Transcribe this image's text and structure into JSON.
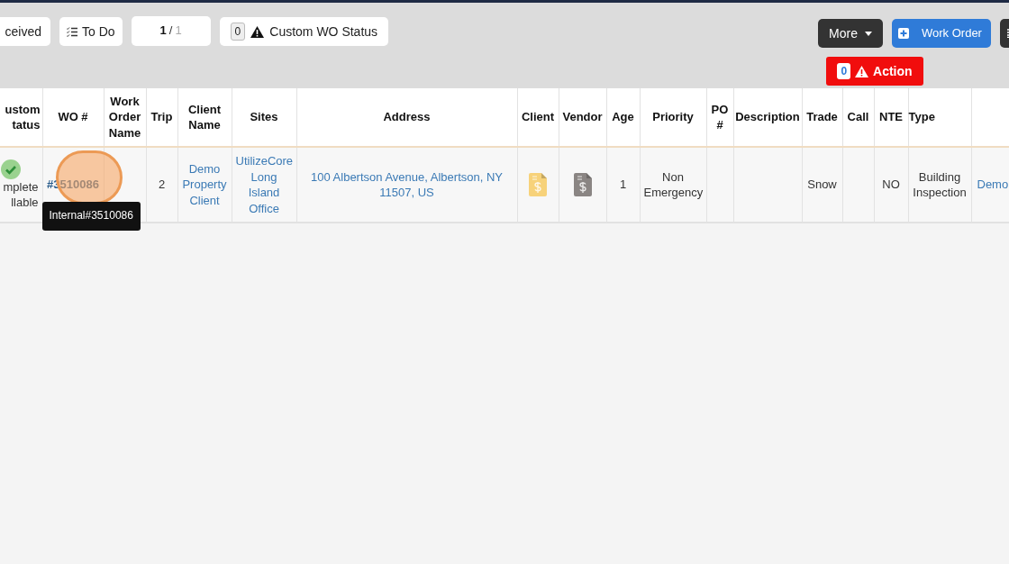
{
  "toolbar": {
    "status_button": {
      "label": "ceived"
    },
    "todo_button": {
      "label": "To Do"
    },
    "pager": {
      "current": "1",
      "separator": "/",
      "total": "1"
    },
    "custom_status_button": {
      "count": "0",
      "label": "Custom WO Status"
    },
    "more_button": {
      "label": "More"
    },
    "work_order_button": {
      "label": "Work Order"
    },
    "action_button": {
      "count": "0",
      "label": "Action"
    }
  },
  "table": {
    "columns": [
      "ustom tatus",
      "WO #",
      "Work Order Name",
      "Trip",
      "Client Name",
      "Sites",
      "Address",
      "Client",
      "Vendor",
      "Age",
      "Priority",
      "PO #",
      "Description",
      "Trade",
      "Call",
      "NTE",
      "Type",
      ""
    ],
    "rows": [
      {
        "cells": [
          {
            "kind": "status",
            "text": "mplete llable"
          },
          {
            "kind": "wo",
            "text": "#3510086",
            "tooltip": "Internal#3510086"
          },
          {
            "kind": "text",
            "text": ""
          },
          {
            "kind": "text",
            "text": "2"
          },
          {
            "kind": "link",
            "text": "Demo Property Client"
          },
          {
            "kind": "link",
            "text": "UtilizeCore Long Island Office"
          },
          {
            "kind": "link",
            "text": "100 Albertson Avenue, Albertson, NY 11507, US"
          },
          {
            "kind": "doc",
            "color": "#f7d27a"
          },
          {
            "kind": "doc",
            "color": "#8a8583"
          },
          {
            "kind": "text",
            "text": "1"
          },
          {
            "kind": "text",
            "text": "Non Emergency"
          },
          {
            "kind": "text",
            "text": ""
          },
          {
            "kind": "text",
            "text": ""
          },
          {
            "kind": "text",
            "text": "Snow"
          },
          {
            "kind": "text",
            "text": ""
          },
          {
            "kind": "text",
            "text": "NO"
          },
          {
            "kind": "text",
            "text": "Building Inspection"
          },
          {
            "kind": "link",
            "text": "Demo"
          }
        ]
      }
    ]
  }
}
